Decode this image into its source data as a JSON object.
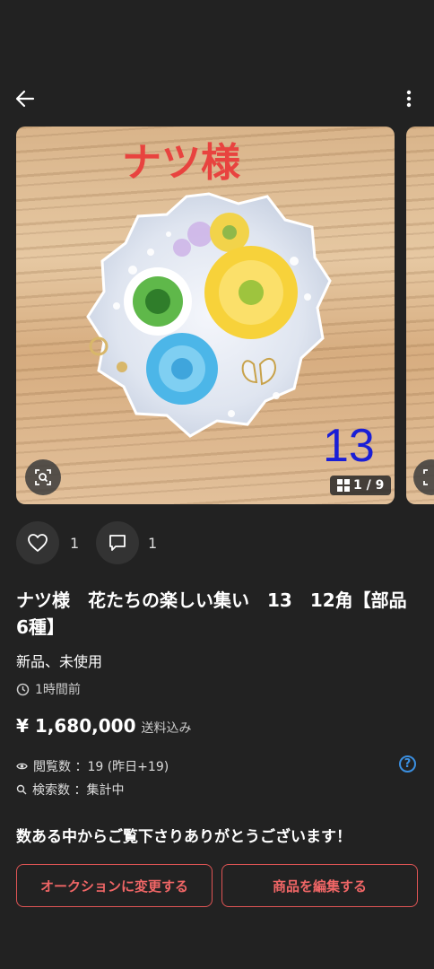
{
  "header": {
    "back_icon": "arrow-left-icon",
    "more_icon": "vertical-dots-icon"
  },
  "gallery": {
    "overlay_text": "ナツ様",
    "overlay_number": "13",
    "counter": "1 / 9",
    "scan_icon": "image-search-icon",
    "grid_icon": "grid-icon"
  },
  "social": {
    "likes": "1",
    "comments": "1",
    "like_icon": "heart-outline-icon",
    "comment_icon": "speech-bubble-icon"
  },
  "item": {
    "title": "ナツ様　花たちの楽しい集い　13　12角【部品6種】",
    "condition": "新品、未使用",
    "posted": "1時間前",
    "price": "¥ 1,680,000",
    "shipping": "送料込み",
    "views": "閲覧数 ：19 (昨日+19)",
    "searches": "検索数 ：集計中",
    "message": "数ある中からご覧下さりありがとうございます！"
  },
  "actions": {
    "auction": "オークションに変更する",
    "edit": "商品を編集する"
  },
  "colors": {
    "background": "#222222",
    "accent_red": "#e05555",
    "help_blue": "#3b8fe0"
  }
}
